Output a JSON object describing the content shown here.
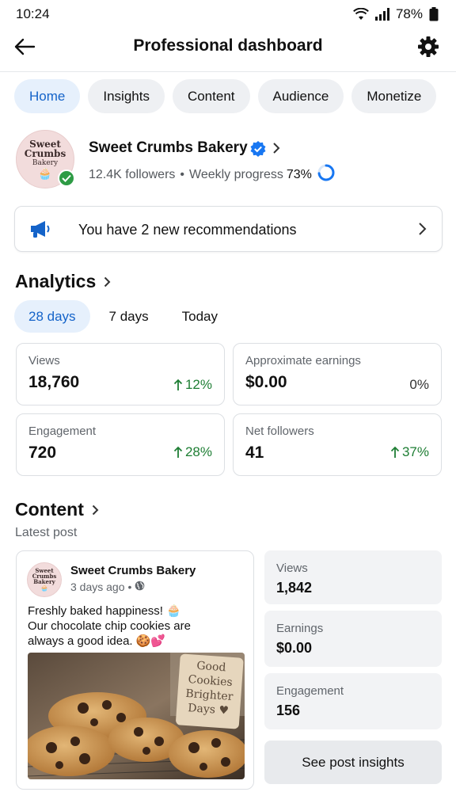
{
  "status": {
    "time": "10:24",
    "battery": "78%"
  },
  "appbar": {
    "title": "Professional dashboard"
  },
  "tabs": [
    {
      "label": "Home",
      "active": true
    },
    {
      "label": "Insights",
      "active": false
    },
    {
      "label": "Content",
      "active": false
    },
    {
      "label": "Audience",
      "active": false
    },
    {
      "label": "Monetize",
      "active": false
    }
  ],
  "profile": {
    "name": "Sweet Crumbs Bakery",
    "logo_line1": "Sweet",
    "logo_line2": "Crumbs",
    "logo_line3": "Bakery",
    "followers": "12.4K followers",
    "separator": "•",
    "progress_label": "Weekly progress",
    "progress_pct": "73%",
    "progress_value": 0.73
  },
  "recommendations": {
    "text": "You have 2 new recommendations"
  },
  "analytics": {
    "title": "Analytics",
    "ranges": [
      {
        "label": "28 days",
        "active": true
      },
      {
        "label": "7 days",
        "active": false
      },
      {
        "label": "Today",
        "active": false
      }
    ],
    "cards": [
      {
        "label": "Views",
        "value": "18,760",
        "delta": "12%",
        "trend": "up"
      },
      {
        "label": "Approximate earnings",
        "value": "$0.00",
        "delta": "0%",
        "trend": "neutral"
      },
      {
        "label": "Engagement",
        "value": "720",
        "delta": "28%",
        "trend": "up"
      },
      {
        "label": "Net followers",
        "value": "41",
        "delta": "37%",
        "trend": "up"
      }
    ]
  },
  "content": {
    "title": "Content",
    "latest_label": "Latest post",
    "post": {
      "author": "Sweet Crumbs Bakery",
      "time": "3 days ago",
      "dot": "•",
      "text_line1": "Freshly baked happiness! 🧁",
      "text_line2": "Our chocolate chip cookies are",
      "text_line3": "always a good idea. 🍪💕",
      "sign_text": "Good Cookies Brighter Days ♥"
    },
    "stats": [
      {
        "label": "Views",
        "value": "1,842"
      },
      {
        "label": "Earnings",
        "value": "$0.00"
      },
      {
        "label": "Engagement",
        "value": "156"
      }
    ],
    "button_label": "See post insights"
  },
  "colors": {
    "accent": "#1463c9",
    "positive": "#1e7e34",
    "verified": "#1877f2",
    "badge": "#2e9b45"
  }
}
